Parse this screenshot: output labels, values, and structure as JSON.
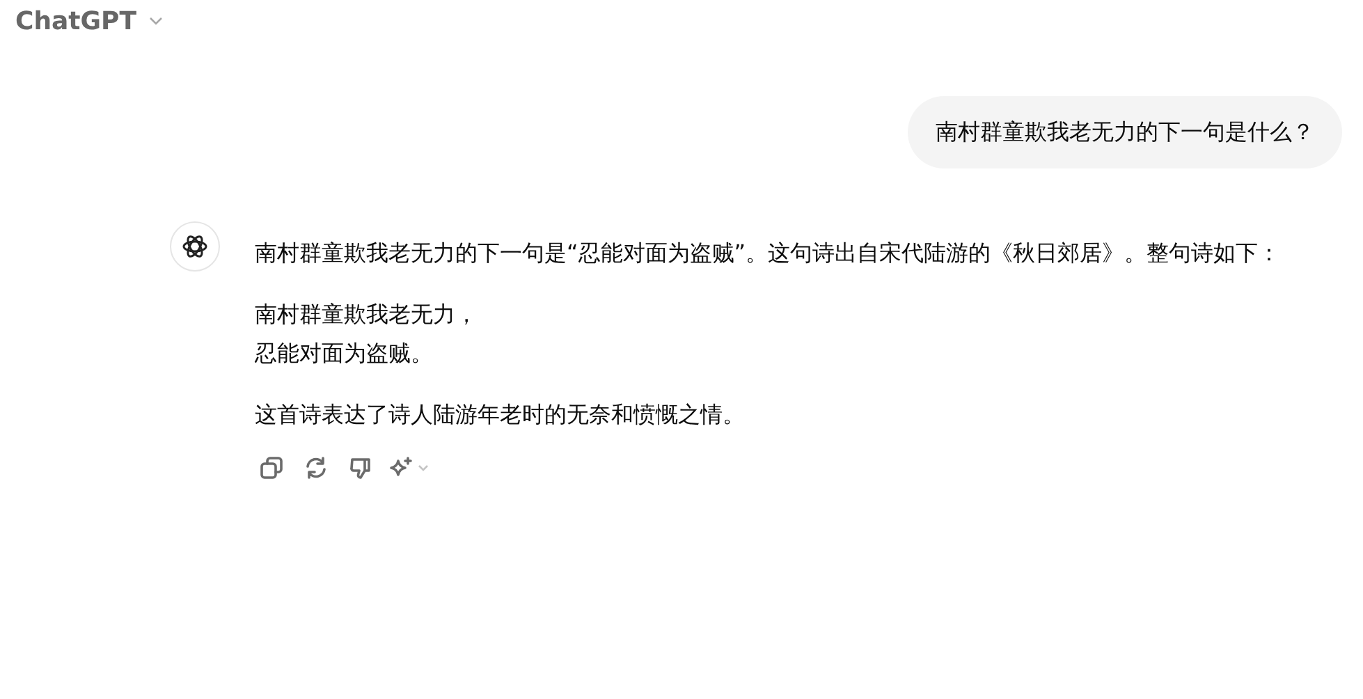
{
  "header": {
    "title": "ChatGPT"
  },
  "messages": [
    {
      "kind": "user",
      "text": "南村群童欺我老无力的下一句是什么？"
    },
    {
      "kind": "assistant",
      "paragraphs": [
        {
          "lines": [
            "南村群童欺我老无力的下一句是“忍能对面为盗贼”。这句诗出自宋代陆游的《秋日郊居》。整句诗如下："
          ]
        },
        {
          "lines": [
            "南村群童欺我老无力，",
            "忍能对面为盗贼。"
          ]
        },
        {
          "lines": [
            "这首诗表达了诗人陆游年老时的无奈和愤慨之情。"
          ]
        }
      ],
      "actions": [
        {
          "kind": "copy"
        },
        {
          "kind": "regenerate"
        },
        {
          "kind": "dislike"
        },
        {
          "kind": "sparkle"
        }
      ]
    }
  ]
}
